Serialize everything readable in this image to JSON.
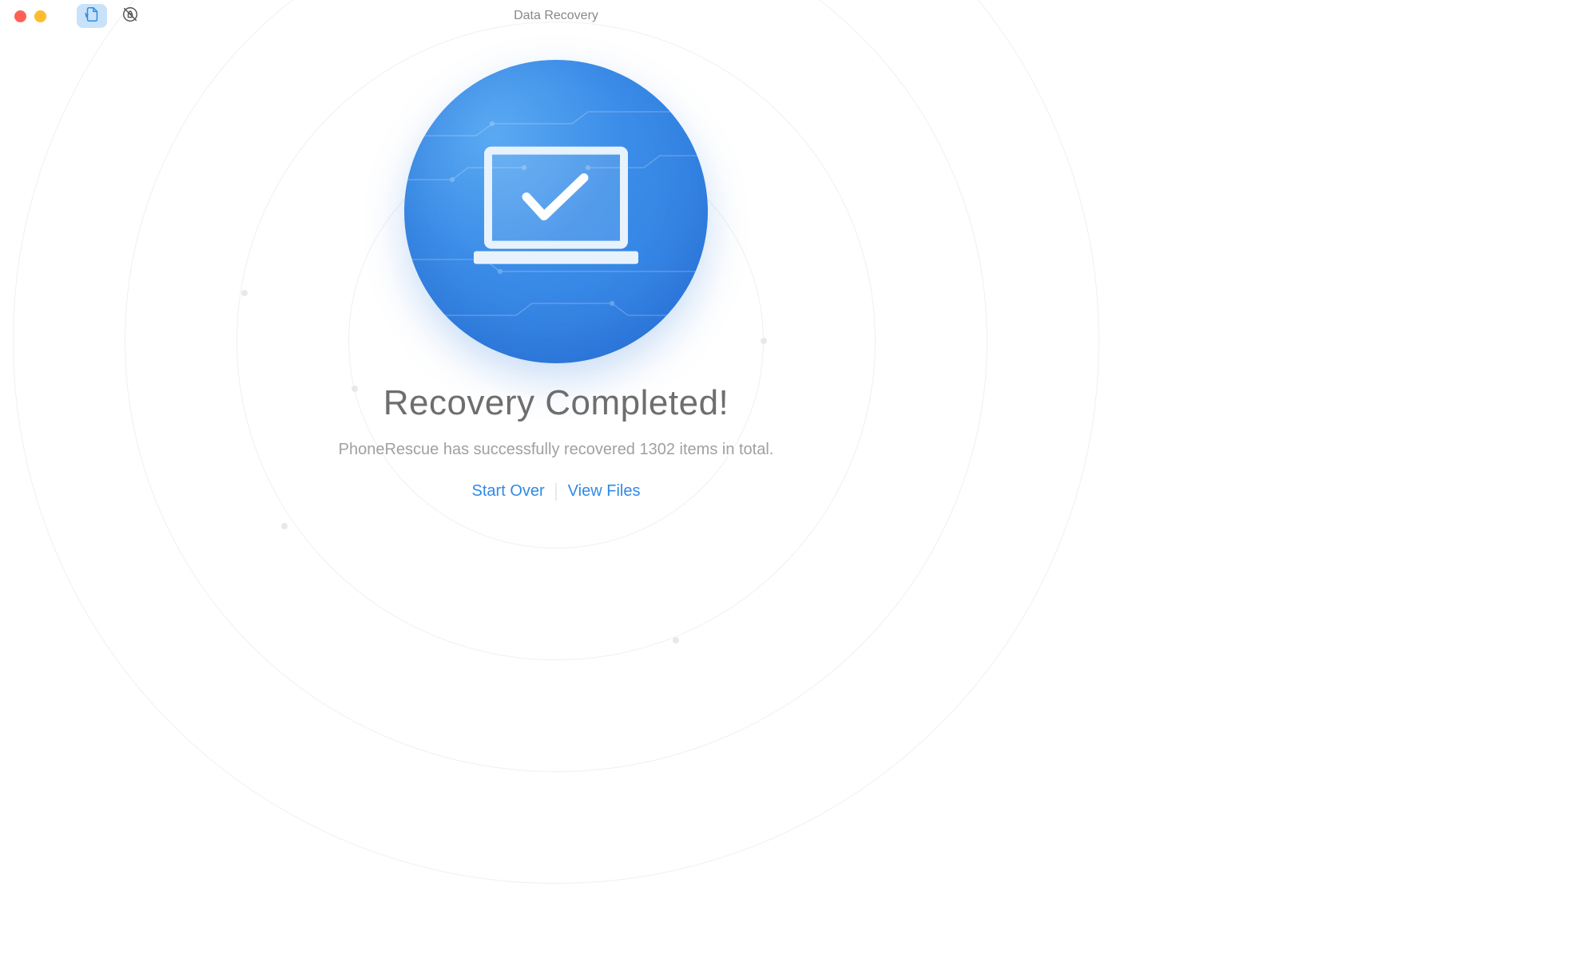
{
  "window": {
    "title": "Data Recovery"
  },
  "toolbar": {
    "recovery_icon": "data-recovery-icon",
    "lock_icon": "lock-restore-icon"
  },
  "main": {
    "headline": "Recovery Completed!",
    "subtext": "PhoneRescue has successfully recovered 1302 items in total.",
    "recovered_count": 1302
  },
  "actions": {
    "start_over": "Start Over",
    "view_files": "View Files"
  },
  "colors": {
    "accent": "#2f8ae6",
    "hero_gradient_start": "#5aa9f2",
    "hero_gradient_end": "#2d7ae0",
    "text_muted": "#a0a0a0",
    "text_heading": "#6e6e6e"
  }
}
